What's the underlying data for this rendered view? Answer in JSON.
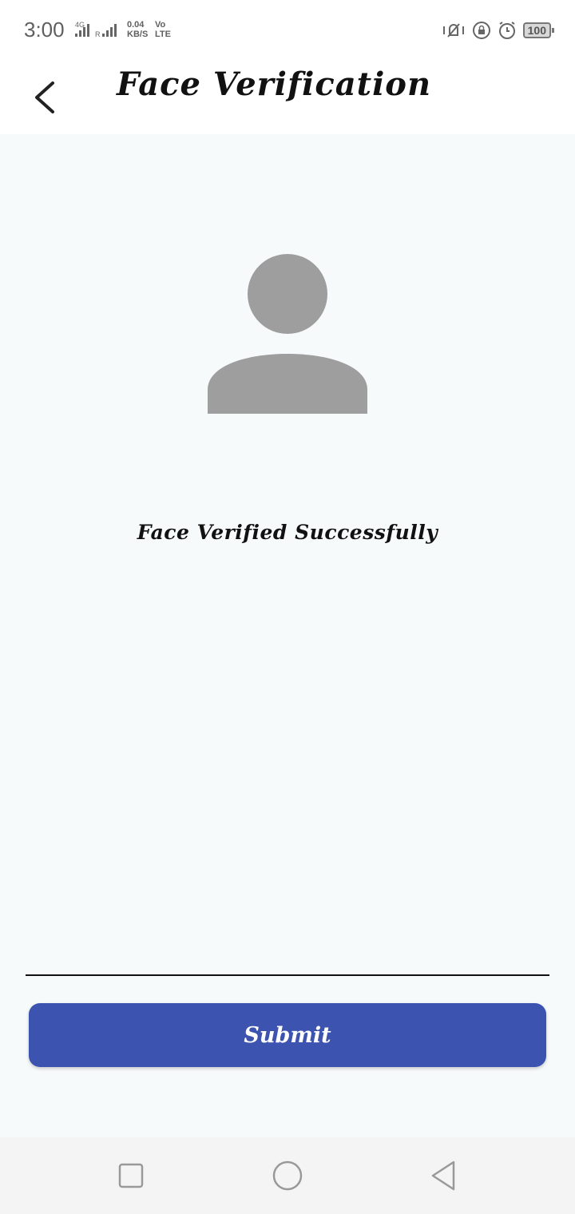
{
  "status_bar": {
    "time": "3:00",
    "network_type": "4G",
    "roaming": "R",
    "speed_value": "0.04",
    "speed_unit": "KB/S",
    "volte_top": "Vo",
    "volte_bottom": "LTE",
    "battery": "100",
    "icons": [
      "vibrate-icon",
      "screen-lock-icon",
      "alarm-icon",
      "battery-icon"
    ]
  },
  "app_bar": {
    "title": "Face Verification",
    "back_icon": "back-arrow-icon"
  },
  "main": {
    "avatar_icon": "person-placeholder-icon",
    "status_message": "Face Verified Successfully"
  },
  "actions": {
    "submit_label": "Submit"
  },
  "nav_bar": {
    "icons": [
      "recents-icon",
      "home-icon",
      "back-icon"
    ]
  },
  "colors": {
    "background": "#f7fafb",
    "primary_button": "#3d53b0",
    "avatar": "#9e9e9e",
    "text": "#111111"
  }
}
